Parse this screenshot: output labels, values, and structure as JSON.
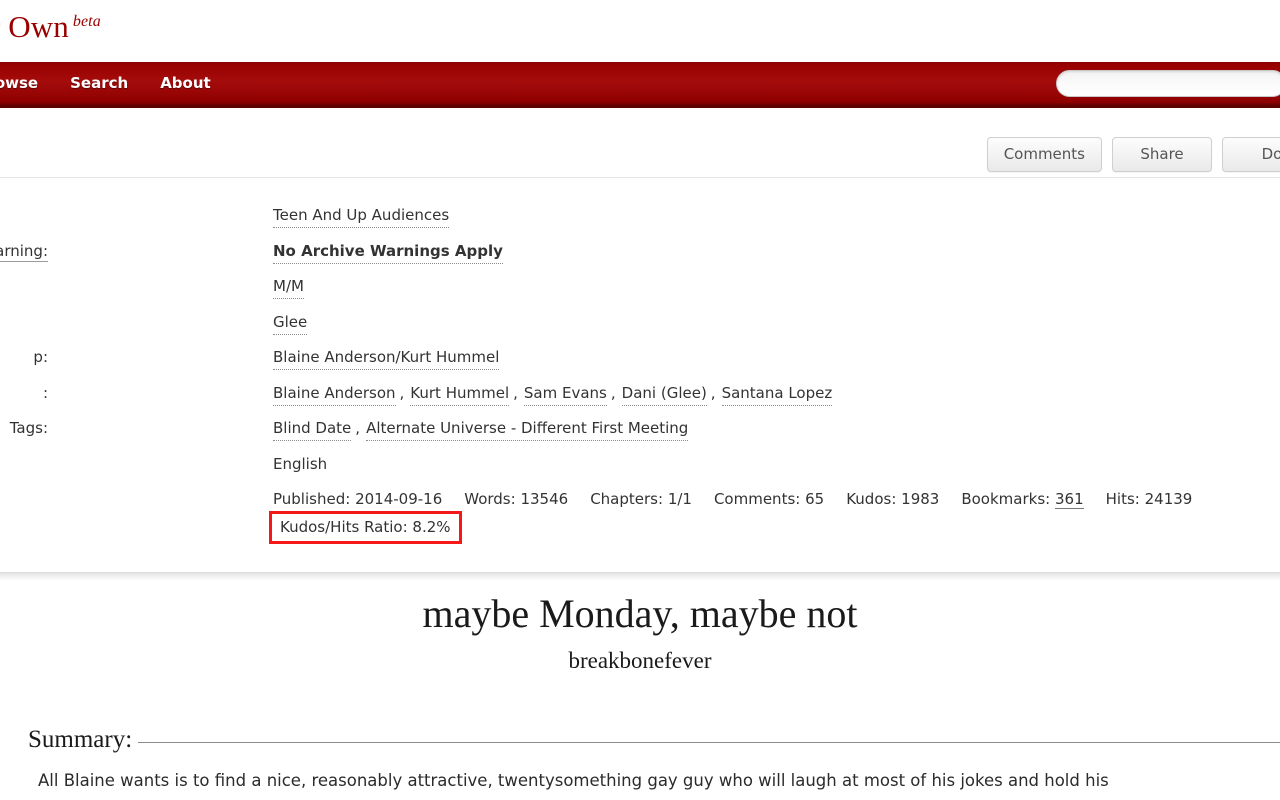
{
  "site": {
    "title_visible": "ive of Our Own",
    "beta_label": "beta",
    "nav": [
      {
        "label": "Browse"
      },
      {
        "label": "Search"
      },
      {
        "label": "About"
      }
    ],
    "search": {
      "value": "",
      "placeholder": ""
    }
  },
  "actions": [
    {
      "label": "Comments"
    },
    {
      "label": "Share"
    },
    {
      "label": "Do"
    }
  ],
  "meta": {
    "rows": [
      {
        "label": "",
        "label_is_link": false,
        "values": [
          {
            "text": "Teen And Up Audiences",
            "type": "tag"
          }
        ]
      },
      {
        "label": "arning:",
        "label_is_link": true,
        "values": [
          {
            "text": "No Archive Warnings Apply",
            "type": "tag-bold"
          }
        ]
      },
      {
        "label": "",
        "label_is_link": false,
        "values": [
          {
            "text": "M/M",
            "type": "tag"
          }
        ]
      },
      {
        "label": "",
        "label_is_link": false,
        "values": [
          {
            "text": "Glee",
            "type": "tag"
          }
        ]
      },
      {
        "label": "p:",
        "label_is_link": false,
        "values": [
          {
            "text": "Blaine Anderson/Kurt Hummel",
            "type": "tag"
          }
        ]
      },
      {
        "label": ":",
        "label_is_link": false,
        "values": [
          {
            "text": "Blaine Anderson",
            "type": "tag",
            "sep": ","
          },
          {
            "text": "Kurt Hummel",
            "type": "tag",
            "sep": ","
          },
          {
            "text": "Sam Evans",
            "type": "tag",
            "sep": ","
          },
          {
            "text": "Dani (Glee)",
            "type": "tag",
            "sep": ","
          },
          {
            "text": "Santana Lopez",
            "type": "tag",
            "sep": ""
          }
        ]
      },
      {
        "label": "Tags:",
        "label_is_link": false,
        "values": [
          {
            "text": "Blind Date",
            "type": "tag",
            "sep": ","
          },
          {
            "text": "Alternate Universe - Different First Meeting",
            "type": "tag",
            "sep": ""
          }
        ]
      },
      {
        "label": "",
        "label_is_link": false,
        "values": [
          {
            "text": "English",
            "type": "plain"
          }
        ]
      }
    ],
    "stats": [
      {
        "label": "Published:",
        "value": "2014-09-16",
        "linked": false
      },
      {
        "label": "Words:",
        "value": "13546",
        "linked": false
      },
      {
        "label": "Chapters:",
        "value": "1/1",
        "linked": false
      },
      {
        "label": "Comments:",
        "value": "65",
        "linked": false
      },
      {
        "label": "Kudos:",
        "value": "1983",
        "linked": false
      },
      {
        "label": "Bookmarks:",
        "value": "361",
        "linked": true
      },
      {
        "label": "Hits:",
        "value": "24139",
        "linked": false
      }
    ],
    "kudos_hits_ratio": {
      "label": "Kudos/Hits Ratio:",
      "value": "8.2%",
      "highlight_color": "#f51818"
    }
  },
  "work": {
    "title": "maybe Monday, maybe not",
    "author": "breakbonefever",
    "summary_heading": "Summary:",
    "summary_text": "All Blaine wants is to find a nice, reasonably attractive, twentysomething gay guy who will laugh at most of his jokes and hold his"
  },
  "colors": {
    "brand_red": "#990000",
    "nav_red": "#a50c0c",
    "highlight_red": "#f51818"
  }
}
